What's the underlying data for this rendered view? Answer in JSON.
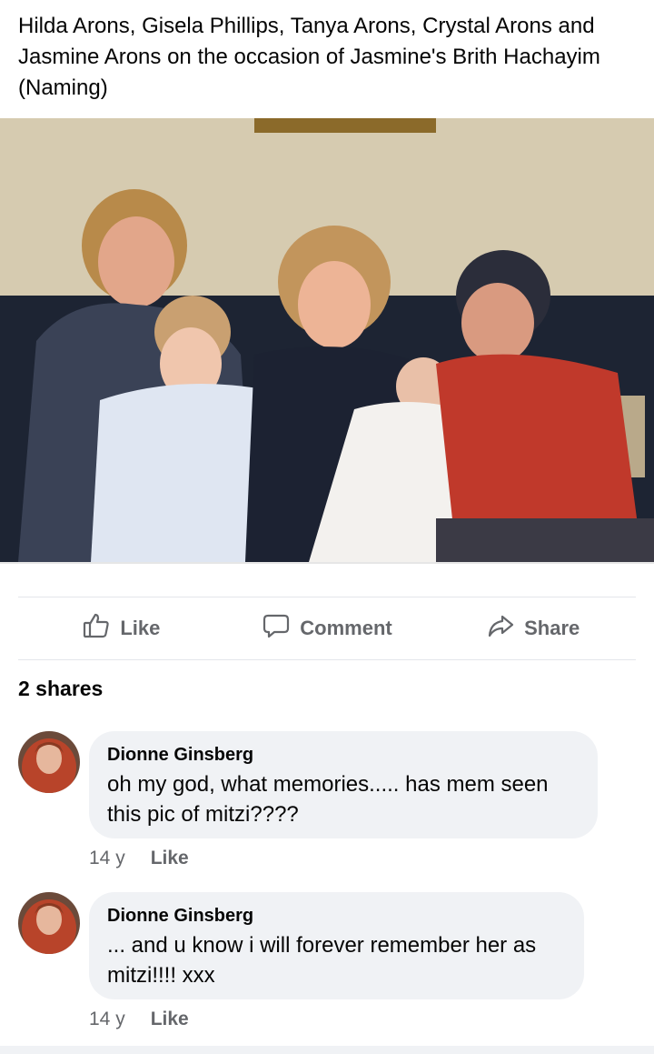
{
  "post": {
    "caption": "Hilda Arons, Gisela Phillips, Tanya Arons, Crystal Arons and Jasmine Arons on the occasion of Jasmine's Brith Hachayim  (Naming)"
  },
  "actions": {
    "like": {
      "label": "Like",
      "icon": "thumbs-up-icon"
    },
    "comment": {
      "label": "Comment",
      "icon": "comment-bubble-icon"
    },
    "share": {
      "label": "Share",
      "icon": "share-arrow-icon"
    }
  },
  "shares_text": "2 shares",
  "comments": [
    {
      "author": "Dionne Ginsberg",
      "text": "oh my god, what memories..... has mem seen this pic of mitzi????",
      "age": "14 y",
      "like_label": "Like"
    },
    {
      "author": "Dionne Ginsberg",
      "text": "... and u know i will forever remember her as mitzi!!!! xxx",
      "age": "14 y",
      "like_label": "Like"
    }
  ],
  "colors": {
    "muted_text": "#65676b",
    "bubble_bg": "#f0f2f5",
    "divider": "#e4e6eb"
  }
}
